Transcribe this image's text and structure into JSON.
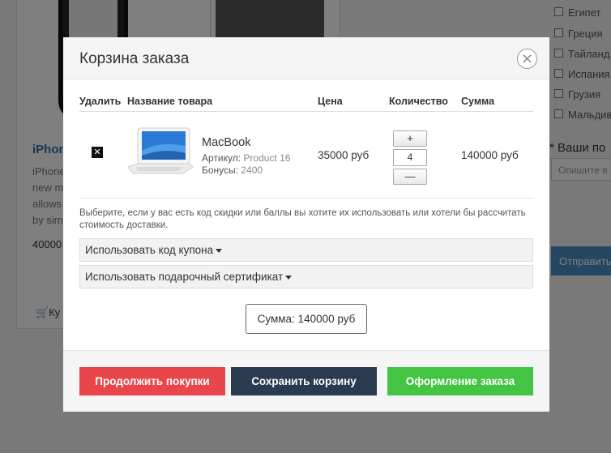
{
  "background": {
    "product_title": "iPhon",
    "desc_lines": [
      "iPhone",
      "new m",
      "allows",
      "by sim"
    ],
    "price": "40000",
    "cart_btn": "Ку",
    "countries": [
      "Египет",
      "Греция",
      "Тайланд",
      "Испания",
      "Грузия",
      "Мальдив"
    ],
    "wishes_label": "* Ваши по",
    "wishes_hint": "Опишите в",
    "send_btn": "Отправить"
  },
  "modal": {
    "title": "Корзина заказа",
    "close_icon": "⨯",
    "columns": {
      "delete": "Удалить",
      "name": "Название товара",
      "price": "Цена",
      "quantity": "Количество",
      "sum": "Сумма"
    },
    "item": {
      "delete_glyph": "✕",
      "name": "MacBook",
      "sku_label": "Артикул:",
      "sku_value": "Product 16",
      "bonus_label": "Бонусы:",
      "bonus_value": "2400",
      "price": "35000 руб",
      "quantity": "4",
      "plus": "+",
      "minus": "—",
      "sum": "140000 руб"
    },
    "note": "Выберите, если у вас есть код скидки или баллы вы хотите их использовать или хотели бы рассчитать стоимость доставки.",
    "coupon_label": "Использовать код купона",
    "certificate_label": "Использовать подарочный сертификат",
    "total": "Сумма: 140000 руб",
    "buttons": {
      "continue": "Продолжить покупки",
      "save": "Сохранить корзину",
      "checkout": "Оформление заказа"
    },
    "colors": {
      "continue": "#e8464b",
      "save": "#2a3a4f",
      "checkout": "#43c443"
    }
  }
}
